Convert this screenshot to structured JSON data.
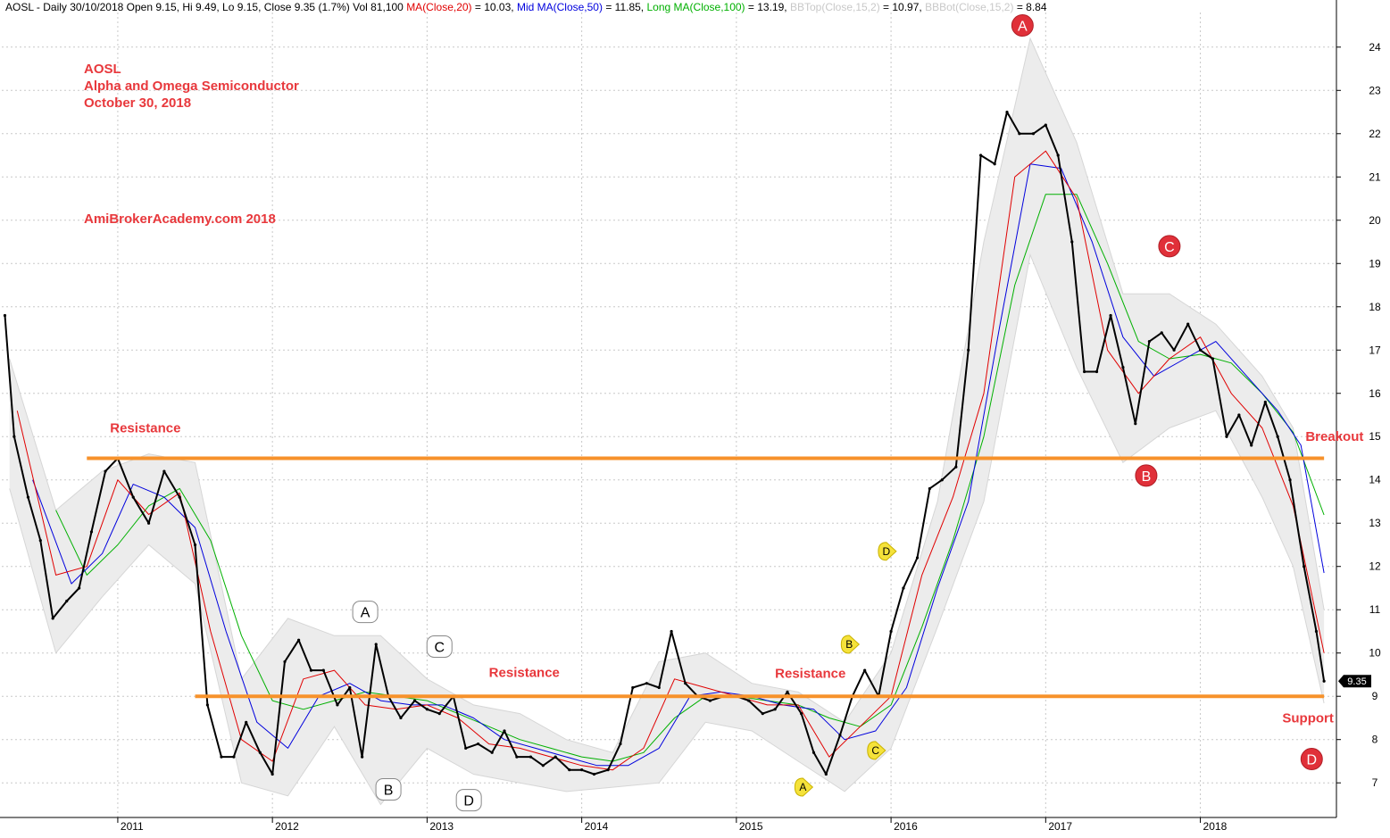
{
  "header": {
    "symbol_line": "AOSL - Daily 30/10/2018 Open 9.15, Hi 9.49, Lo 9.15, Close 9.35 (1.7%) Vol 81,100",
    "ma20_label": "MA(Close,20)",
    "ma20_value": "= 10.03,",
    "ma50_label": "Mid MA(Close,50)",
    "ma50_value": "= 11.85,",
    "ma100_label": "Long MA(Close,100)",
    "ma100_value": "= 13.19,",
    "bbtop_label": "BBTop(Close,15,2)",
    "bbtop_value": "= 10.97,",
    "bbbot_label": "BBBot(Close,15,2)",
    "bbbot_value": "= 8.84"
  },
  "notes": {
    "line1": "AOSL",
    "line2": "Alpha and Omega Semiconductor",
    "line3": "October 30, 2018",
    "watermark": "AmiBrokerAcademy.com  2018"
  },
  "colors": {
    "price": "#000000",
    "ma20": "#e00000",
    "ma50": "#0000dd",
    "ma100": "#00b000",
    "bollinger": "#d6d6d6",
    "level_line": "#f7922b",
    "annotation_text": "#e8383c",
    "red_marker": "#e03039",
    "yellow_marker": "#f5e23a",
    "grid": "#c8c8c8"
  },
  "chart_data": {
    "type": "line",
    "title": "AOSL - Daily",
    "subtitle": "Alpha and Omega Semiconductor, October 30, 2018",
    "x_range": [
      2010.25,
      2018.88
    ],
    "y_range": [
      6.2,
      24.8
    ],
    "y_ticks": [
      7,
      8,
      9,
      10,
      11,
      12,
      13,
      14,
      15,
      16,
      17,
      18,
      19,
      20,
      21,
      22,
      23,
      24
    ],
    "x_ticks": [
      {
        "label": "2011",
        "x": 2011.0
      },
      {
        "label": "2012",
        "x": 2012.0
      },
      {
        "label": "2013",
        "x": 2013.0
      },
      {
        "label": "2014",
        "x": 2014.0
      },
      {
        "label": "2015",
        "x": 2015.0
      },
      {
        "label": "2016",
        "x": 2016.0
      },
      {
        "label": "2017",
        "x": 2017.0
      },
      {
        "label": "2018",
        "x": 2018.0
      }
    ],
    "grid": true,
    "last_price": 9.35,
    "last_price_label": "9.35",
    "series": [
      {
        "name": "Close",
        "x": [
          2010.27,
          2010.33,
          2010.42,
          2010.5,
          2010.58,
          2010.67,
          2010.75,
          2010.83,
          2010.92,
          2011.0,
          2011.1,
          2011.2,
          2011.3,
          2011.4,
          2011.5,
          2011.58,
          2011.67,
          2011.75,
          2011.83,
          2011.92,
          2012.0,
          2012.08,
          2012.17,
          2012.25,
          2012.33,
          2012.42,
          2012.5,
          2012.58,
          2012.67,
          2012.75,
          2012.83,
          2012.92,
          2013.0,
          2013.08,
          2013.17,
          2013.25,
          2013.33,
          2013.42,
          2013.5,
          2013.58,
          2013.67,
          2013.75,
          2013.83,
          2013.92,
          2014.0,
          2014.08,
          2014.17,
          2014.25,
          2014.33,
          2014.42,
          2014.5,
          2014.58,
          2014.67,
          2014.75,
          2014.83,
          2014.92,
          2015.0,
          2015.08,
          2015.17,
          2015.25,
          2015.33,
          2015.42,
          2015.5,
          2015.58,
          2015.67,
          2015.75,
          2015.83,
          2015.92,
          2016.0,
          2016.08,
          2016.17,
          2016.25,
          2016.33,
          2016.42,
          2016.5,
          2016.58,
          2016.67,
          2016.75,
          2016.83,
          2016.92,
          2017.0,
          2017.08,
          2017.17,
          2017.25,
          2017.33,
          2017.42,
          2017.5,
          2017.58,
          2017.67,
          2017.75,
          2017.83,
          2017.92,
          2018.0,
          2018.08,
          2018.17,
          2018.25,
          2018.33,
          2018.42,
          2018.5,
          2018.58,
          2018.67,
          2018.75,
          2018.8
        ],
        "values": [
          17.8,
          15.0,
          13.6,
          12.6,
          10.8,
          11.2,
          11.5,
          12.8,
          14.2,
          14.5,
          13.6,
          13.0,
          14.2,
          13.6,
          12.5,
          8.8,
          7.6,
          7.6,
          8.4,
          7.7,
          7.2,
          9.8,
          10.3,
          9.6,
          9.6,
          8.8,
          9.2,
          7.6,
          10.2,
          9.0,
          8.5,
          8.9,
          8.7,
          8.6,
          9.0,
          7.8,
          7.9,
          7.7,
          8.2,
          7.6,
          7.6,
          7.4,
          7.6,
          7.3,
          7.3,
          7.2,
          7.3,
          7.9,
          9.2,
          9.3,
          9.2,
          10.5,
          9.3,
          9.0,
          8.9,
          9.0,
          9.0,
          8.9,
          8.6,
          8.7,
          9.1,
          8.6,
          7.7,
          7.2,
          8.1,
          9.0,
          9.6,
          9.0,
          10.5,
          11.5,
          12.2,
          13.8,
          14.0,
          14.3,
          17.0,
          21.5,
          21.3,
          22.5,
          22.0,
          22.0,
          22.2,
          21.5,
          19.5,
          16.5,
          16.5,
          17.8,
          16.6,
          15.3,
          17.2,
          17.4,
          17.0,
          17.6,
          17.0,
          16.8,
          15.0,
          15.5,
          14.8,
          15.8,
          15.0,
          14.0,
          12.0,
          10.5,
          9.35
        ]
      },
      {
        "name": "MA(Close,20)",
        "x": [
          2010.35,
          2010.6,
          2010.8,
          2011.0,
          2011.2,
          2011.4,
          2011.6,
          2011.8,
          2012.0,
          2012.2,
          2012.4,
          2012.6,
          2012.8,
          2013.0,
          2013.2,
          2013.4,
          2013.6,
          2013.8,
          2014.0,
          2014.2,
          2014.4,
          2014.6,
          2014.8,
          2015.0,
          2015.2,
          2015.4,
          2015.6,
          2015.8,
          2016.0,
          2016.2,
          2016.4,
          2016.6,
          2016.8,
          2017.0,
          2017.2,
          2017.4,
          2017.6,
          2017.8,
          2018.0,
          2018.2,
          2018.4,
          2018.6,
          2018.8
        ],
        "values": [
          15.6,
          11.8,
          12.0,
          14.0,
          13.2,
          13.7,
          10.5,
          8.0,
          7.5,
          9.4,
          9.6,
          8.8,
          8.7,
          8.8,
          8.5,
          7.9,
          7.8,
          7.6,
          7.4,
          7.3,
          7.8,
          9.4,
          9.2,
          9.0,
          8.8,
          8.8,
          7.6,
          8.3,
          9.0,
          11.8,
          13.6,
          16.0,
          21.0,
          21.6,
          20.5,
          17.0,
          16.0,
          16.8,
          17.3,
          16.0,
          15.2,
          13.4,
          10.0
        ]
      },
      {
        "name": "MA(Close,50)",
        "x": [
          2010.45,
          2010.7,
          2010.9,
          2011.1,
          2011.3,
          2011.5,
          2011.7,
          2011.9,
          2012.1,
          2012.3,
          2012.5,
          2012.7,
          2012.9,
          2013.1,
          2013.3,
          2013.5,
          2013.7,
          2013.9,
          2014.1,
          2014.3,
          2014.5,
          2014.7,
          2014.9,
          2015.1,
          2015.3,
          2015.5,
          2015.7,
          2015.9,
          2016.1,
          2016.3,
          2016.5,
          2016.7,
          2016.9,
          2017.1,
          2017.3,
          2017.5,
          2017.7,
          2017.9,
          2018.1,
          2018.3,
          2018.5,
          2018.65,
          2018.8
        ],
        "values": [
          14.0,
          11.6,
          12.3,
          13.9,
          13.6,
          12.9,
          10.5,
          8.4,
          7.8,
          9.0,
          9.3,
          8.9,
          8.8,
          8.8,
          8.5,
          8.0,
          7.8,
          7.6,
          7.4,
          7.4,
          7.8,
          9.0,
          9.1,
          9.0,
          8.8,
          8.7,
          8.0,
          8.2,
          9.2,
          11.5,
          13.5,
          17.5,
          21.3,
          21.2,
          19.5,
          17.3,
          16.4,
          16.8,
          17.2,
          16.4,
          15.6,
          14.8,
          11.85
        ]
      },
      {
        "name": "MA(Close,100)",
        "x": [
          2010.6,
          2010.8,
          2011.0,
          2011.2,
          2011.4,
          2011.6,
          2011.8,
          2012.0,
          2012.2,
          2012.4,
          2012.6,
          2012.8,
          2013.0,
          2013.2,
          2013.4,
          2013.6,
          2013.8,
          2014.0,
          2014.2,
          2014.4,
          2014.6,
          2014.8,
          2015.0,
          2015.2,
          2015.4,
          2015.6,
          2015.8,
          2016.0,
          2016.2,
          2016.4,
          2016.6,
          2016.8,
          2017.0,
          2017.2,
          2017.4,
          2017.6,
          2017.8,
          2018.0,
          2018.2,
          2018.4,
          2018.6,
          2018.8
        ],
        "values": [
          13.3,
          11.8,
          12.5,
          13.4,
          13.8,
          12.6,
          10.4,
          8.9,
          8.7,
          8.9,
          9.1,
          9.0,
          8.9,
          8.6,
          8.3,
          8.0,
          7.8,
          7.6,
          7.5,
          7.7,
          8.5,
          9.0,
          9.0,
          8.9,
          8.8,
          8.5,
          8.3,
          8.8,
          10.6,
          12.6,
          15.0,
          18.5,
          20.6,
          20.6,
          19.0,
          17.2,
          16.8,
          16.9,
          16.7,
          16.0,
          15.1,
          13.19
        ]
      },
      {
        "name": "BBTop(Close,15,2)",
        "x": [
          2010.3,
          2010.6,
          2010.9,
          2011.2,
          2011.5,
          2011.8,
          2012.1,
          2012.4,
          2012.7,
          2013.0,
          2013.3,
          2013.6,
          2013.9,
          2014.2,
          2014.5,
          2014.8,
          2015.1,
          2015.4,
          2015.7,
          2016.0,
          2016.3,
          2016.6,
          2016.9,
          2017.2,
          2017.5,
          2017.8,
          2018.1,
          2018.4,
          2018.6,
          2018.8
        ],
        "values": [
          16.8,
          13.3,
          14.2,
          14.6,
          14.4,
          9.4,
          10.8,
          10.4,
          10.4,
          9.4,
          8.8,
          8.6,
          8.0,
          7.7,
          9.8,
          10.0,
          9.3,
          9.1,
          8.4,
          10.0,
          13.5,
          19.5,
          24.2,
          21.8,
          18.3,
          18.3,
          17.6,
          16.4,
          15.2,
          11.0
        ]
      },
      {
        "name": "BBBot(Close,15,2)",
        "x": [
          2010.3,
          2010.6,
          2010.9,
          2011.2,
          2011.5,
          2011.8,
          2012.1,
          2012.4,
          2012.7,
          2013.0,
          2013.3,
          2013.6,
          2013.9,
          2014.2,
          2014.5,
          2014.8,
          2015.1,
          2015.4,
          2015.7,
          2016.0,
          2016.3,
          2016.6,
          2016.9,
          2017.2,
          2017.5,
          2017.8,
          2018.1,
          2018.4,
          2018.6,
          2018.8
        ],
        "values": [
          13.8,
          10.0,
          11.3,
          12.5,
          11.6,
          7.0,
          6.7,
          8.3,
          6.5,
          7.8,
          7.2,
          7.0,
          6.8,
          6.9,
          7.0,
          8.4,
          8.2,
          7.5,
          6.8,
          7.8,
          10.6,
          13.5,
          19.2,
          16.6,
          14.4,
          15.2,
          15.6,
          13.6,
          12.0,
          8.84
        ]
      }
    ],
    "horizontal_levels": [
      {
        "y": 14.5,
        "x_start": 2010.8,
        "x_end": 2018.8
      },
      {
        "y": 9.0,
        "x_start": 2011.5,
        "x_end": 2018.8
      }
    ],
    "annotations": [
      {
        "text": "Resistance",
        "x": 2010.95,
        "y": 15.1,
        "anchor": "start"
      },
      {
        "text": "Breakout",
        "x": 2018.68,
        "y": 14.9,
        "anchor": "start"
      },
      {
        "text": "Resistance",
        "x": 2013.4,
        "y": 9.45,
        "anchor": "start"
      },
      {
        "text": "Resistance",
        "x": 2015.25,
        "y": 9.43,
        "anchor": "start"
      },
      {
        "text": "Support",
        "x": 2018.53,
        "y": 8.4,
        "anchor": "start"
      }
    ],
    "wave_markers": [
      {
        "label": "A",
        "style": "red",
        "x": 2016.85,
        "y": 24.5
      },
      {
        "label": "B",
        "style": "red",
        "x": 2017.65,
        "y": 14.1
      },
      {
        "label": "C",
        "style": "red",
        "x": 2017.8,
        "y": 19.4
      },
      {
        "label": "D",
        "style": "red",
        "x": 2018.72,
        "y": 7.55
      },
      {
        "label": "A",
        "style": "white",
        "x": 2012.6,
        "y": 10.95
      },
      {
        "label": "B",
        "style": "white",
        "x": 2012.75,
        "y": 6.85
      },
      {
        "label": "C",
        "style": "white",
        "x": 2013.08,
        "y": 10.15
      },
      {
        "label": "D",
        "style": "white",
        "x": 2013.27,
        "y": 6.6
      },
      {
        "label": "A",
        "style": "yellow",
        "x": 2015.43,
        "y": 6.9
      },
      {
        "label": "B",
        "style": "yellow",
        "x": 2015.73,
        "y": 10.2
      },
      {
        "label": "C",
        "style": "yellow",
        "x": 2015.9,
        "y": 7.75
      },
      {
        "label": "D",
        "style": "yellow",
        "x": 2015.97,
        "y": 12.35
      }
    ]
  }
}
